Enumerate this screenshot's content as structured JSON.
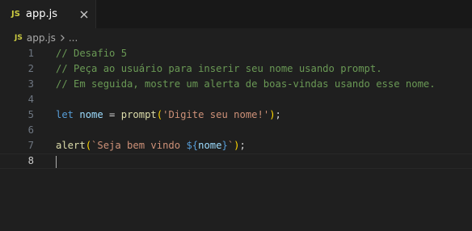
{
  "tab": {
    "icon_text": "JS",
    "label": "app.js"
  },
  "breadcrumb": {
    "icon_text": "JS",
    "file": "app.js",
    "ellipsis": "..."
  },
  "editor": {
    "current_line": 8,
    "lines": [
      {
        "number": "1",
        "tokens": [
          {
            "type": "comment",
            "text": "// Desafio 5"
          }
        ]
      },
      {
        "number": "2",
        "tokens": [
          {
            "type": "comment",
            "text": "// Peça ao usuário para inserir seu nome usando prompt."
          }
        ]
      },
      {
        "number": "3",
        "tokens": [
          {
            "type": "comment",
            "text": "// Em seguida, mostre um alerta de boas-vindas usando esse nome."
          }
        ]
      },
      {
        "number": "4",
        "tokens": []
      },
      {
        "number": "5",
        "tokens": [
          {
            "type": "keyword",
            "text": "let"
          },
          {
            "type": "punct",
            "text": " "
          },
          {
            "type": "variable",
            "text": "nome"
          },
          {
            "type": "operator",
            "text": " = "
          },
          {
            "type": "function",
            "text": "prompt"
          },
          {
            "type": "paren",
            "text": "("
          },
          {
            "type": "string",
            "text": "'Digite seu nome!'"
          },
          {
            "type": "paren",
            "text": ")"
          },
          {
            "type": "punct",
            "text": ";"
          }
        ]
      },
      {
        "number": "6",
        "tokens": []
      },
      {
        "number": "7",
        "tokens": [
          {
            "type": "function",
            "text": "alert"
          },
          {
            "type": "paren",
            "text": "("
          },
          {
            "type": "string",
            "text": "`Seja bem vindo "
          },
          {
            "type": "template-brace",
            "text": "${"
          },
          {
            "type": "variable",
            "text": "nome"
          },
          {
            "type": "template-brace",
            "text": "}"
          },
          {
            "type": "string",
            "text": "`"
          },
          {
            "type": "paren",
            "text": ")"
          },
          {
            "type": "punct",
            "text": ";"
          }
        ]
      },
      {
        "number": "8",
        "tokens": []
      }
    ]
  },
  "colors": {
    "editor_background": "#1f1f1f",
    "tab_strip_background": "#181818",
    "comment": "#6a9955",
    "keyword": "#569cd6",
    "variable": "#9cdcfe",
    "function": "#dcdcaa",
    "string": "#ce9178",
    "bracket": "#ffd700",
    "js_icon": "#cbcb41"
  },
  "icons": {
    "close": "close-icon",
    "breadcrumb_separator": "chevron-right-icon"
  }
}
